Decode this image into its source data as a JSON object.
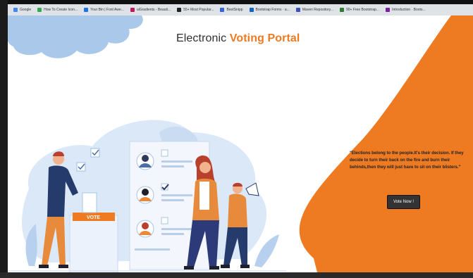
{
  "bookmarks": [
    {
      "label": "Google",
      "color": "#4285f4"
    },
    {
      "label": "How To Create Icon...",
      "color": "#34a853"
    },
    {
      "label": "Your Bin | Font Awe...",
      "color": "#1a73e8"
    },
    {
      "label": "uiGradients - Beauti...",
      "color": "#c2185b"
    },
    {
      "label": "55+ Most Popular...",
      "color": "#222222"
    },
    {
      "label": "BootSnipp",
      "color": "#3367d6"
    },
    {
      "label": "Bootstrap Forms · a...",
      "color": "#1565c0"
    },
    {
      "label": "Maven Repository...",
      "color": "#3f51b5"
    },
    {
      "label": "90+ Free Bootstrap...",
      "color": "#2e7d32"
    },
    {
      "label": "Introduction · Boots...",
      "color": "#7b1fa2"
    }
  ],
  "page": {
    "title_plain": "Electronic ",
    "title_accent": "Voting Portal",
    "quote": "\"Elections belong to the people.It's their decision. If they decide to turn their back on the fire and burn their behinds,then they will just have to sit on their blisters.\"",
    "vote_button": "Vote Now !",
    "ballot_box_label": "VOTE"
  },
  "colors": {
    "accent": "#ee7a22",
    "dark_button": "#333333",
    "cloud": "#a9c8ea",
    "blob": "#dbe8f8"
  },
  "icons": {
    "checkmark": "check-icon",
    "megaphone": "megaphone-icon"
  }
}
